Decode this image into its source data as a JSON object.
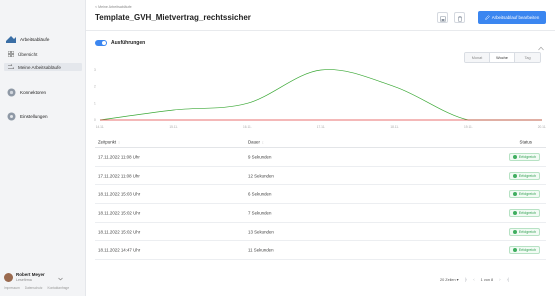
{
  "sidebar": {
    "sections": [
      {
        "icon": "workflow-icon",
        "label": "Arbeitsabläufe"
      },
      {
        "icon": "connector-icon",
        "label": "Konnektoren"
      },
      {
        "icon": "gear-icon",
        "label": "Einstellungen"
      }
    ],
    "sub_items": [
      {
        "icon": "grid-icon",
        "label": "Übersicht"
      },
      {
        "icon": "flow-icon",
        "label": "Meine Arbeitsabläufe"
      }
    ],
    "user": {
      "name": "Robert Meyer",
      "role": "Lesefirma"
    },
    "footer_links": [
      "Impressum",
      "Datenschutz",
      "Kontaktanfrage"
    ]
  },
  "header": {
    "breadcrumb": "< Meine Arbeitsabläufe",
    "title": "Template_GVH_Mietvertrag_rechtssicher",
    "primary_button": "Arbeitsablauf bearbeiten",
    "accent": "#3b86f0"
  },
  "executions": {
    "toggle_label": "Ausführungen",
    "toggle_on": true,
    "range_options": [
      "Monat",
      "Woche",
      "Tag"
    ],
    "selected_range": "Woche"
  },
  "chart_data": {
    "type": "line",
    "x_tick_labels": [
      "14.11.",
      "15.11.",
      "16.11.",
      "17.11.",
      "18.11.",
      "19.11.",
      "20.11."
    ],
    "y_tick_labels": [
      "3",
      "2",
      "1",
      "0"
    ],
    "series": [
      {
        "color": "#3aa835",
        "values": [
          0,
          0.6,
          1.0,
          3.0,
          2.0,
          0,
          0
        ]
      },
      {
        "color": "#e04040",
        "values": [
          0,
          0,
          0,
          0,
          0,
          0,
          0
        ]
      }
    ],
    "ylim": [
      0,
      3
    ],
    "grid": false
  },
  "table": {
    "columns": [
      "Zeitpunkt",
      "Dauer",
      "Status"
    ],
    "rows": [
      {
        "time": "17.11.2022 11:08 Uhr",
        "duration": "9 Sekunden",
        "status": "Erfolgreich"
      },
      {
        "time": "17.11.2022 11:08 Uhr",
        "duration": "12 Sekunden",
        "status": "Erfolgreich"
      },
      {
        "time": "18.11.2022 15:03 Uhr",
        "duration": "6 Sekunden",
        "status": "Erfolgreich"
      },
      {
        "time": "18.11.2022 15:02 Uhr",
        "duration": "7 Sekunden",
        "status": "Erfolgreich"
      },
      {
        "time": "18.11.2022 15:02 Uhr",
        "duration": "13 Sekunden",
        "status": "Erfolgreich"
      },
      {
        "time": "18.11.2022 14:47 Uhr",
        "duration": "11 Sekunden",
        "status": "Erfolgreich"
      }
    ]
  },
  "pagination": {
    "page_size": "20 Zeilen",
    "page_info": "1 von 8"
  }
}
